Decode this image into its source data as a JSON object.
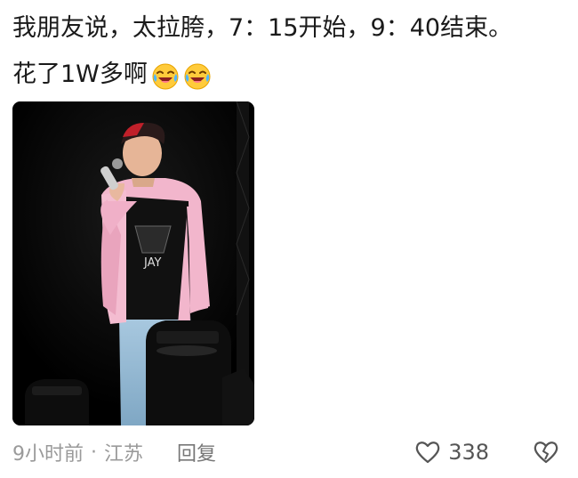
{
  "post": {
    "line1": "我朋友说，太拉胯，7：15开始，9：40结束。",
    "line2": "花了1W多啊",
    "emojis": [
      "laughing-crying-emoji",
      "laughing-crying-emoji"
    ],
    "photo": {
      "shirt_text": "JAY"
    }
  },
  "footer": {
    "time": "9小时前",
    "separator": "·",
    "location": "江苏",
    "reply_label": "回复",
    "likes": "338",
    "like_icon": "heart-icon",
    "dislike_icon": "broken-heart-icon"
  },
  "colors": {
    "text": "#1a1a1a",
    "meta": "#9a9a9a",
    "icon": "#555555"
  }
}
